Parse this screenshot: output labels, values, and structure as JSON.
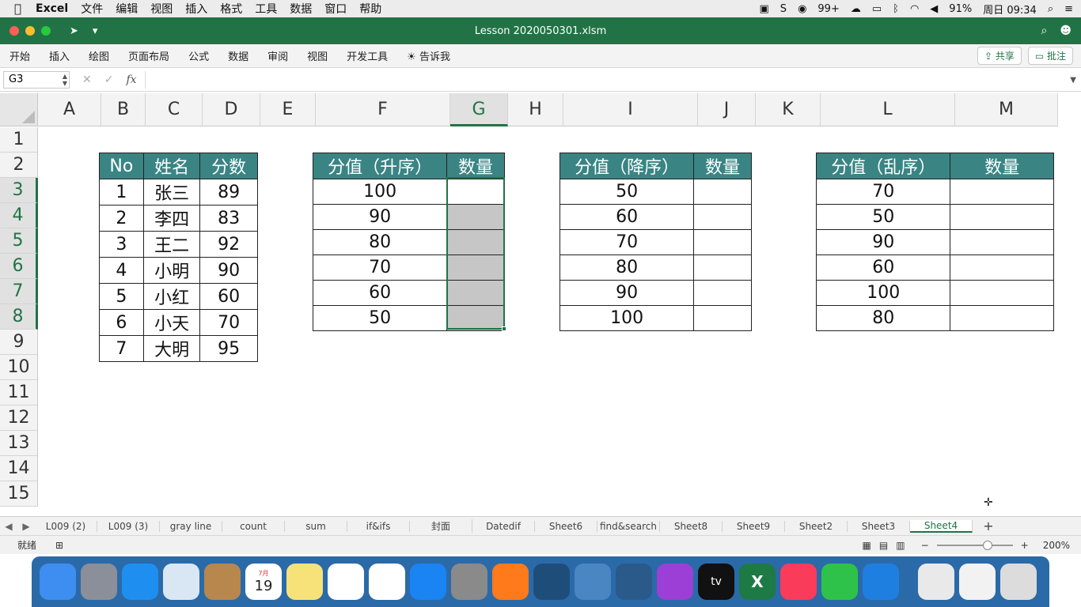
{
  "menubar": {
    "apple": "",
    "app": "Excel",
    "items": [
      "文件",
      "编辑",
      "视图",
      "插入",
      "格式",
      "工具",
      "数据",
      "窗口",
      "帮助"
    ],
    "status": {
      "badge": "99+",
      "battery": "91%",
      "clock": "周日 09:34"
    }
  },
  "window": {
    "title": "Lesson 2020050301.xlsm"
  },
  "ribbon": {
    "tabs": [
      "开始",
      "插入",
      "绘图",
      "页面布局",
      "公式",
      "数据",
      "审阅",
      "视图",
      "开发工具",
      "告诉我"
    ],
    "share": "共享",
    "comments": "批注"
  },
  "formula_bar": {
    "name_box": "G3",
    "fx": "fx",
    "value": ""
  },
  "columns": [
    "A",
    "B",
    "C",
    "D",
    "E",
    "F",
    "G",
    "H",
    "I",
    "J",
    "K",
    "L",
    "M"
  ],
  "rows": [
    "1",
    "2",
    "3",
    "4",
    "5",
    "6",
    "7",
    "8",
    "9",
    "10",
    "11",
    "12",
    "13",
    "14",
    "15"
  ],
  "selected": {
    "col": "G",
    "rows": [
      "3",
      "4",
      "5",
      "6",
      "7",
      "8"
    ]
  },
  "tables": {
    "students": {
      "headers": [
        "No",
        "姓名",
        "分数"
      ],
      "rows": [
        [
          "1",
          "张三",
          "89"
        ],
        [
          "2",
          "李四",
          "83"
        ],
        [
          "3",
          "王二",
          "92"
        ],
        [
          "4",
          "小明",
          "90"
        ],
        [
          "5",
          "小红",
          "60"
        ],
        [
          "6",
          "小天",
          "70"
        ],
        [
          "7",
          "大明",
          "95"
        ]
      ]
    },
    "asc": {
      "headers": [
        "分值（升序）",
        "数量"
      ],
      "values": [
        "100",
        "90",
        "80",
        "70",
        "60",
        "50"
      ]
    },
    "desc": {
      "headers": [
        "分值（降序）",
        "数量"
      ],
      "values": [
        "50",
        "60",
        "70",
        "80",
        "90",
        "100"
      ]
    },
    "random": {
      "headers": [
        "分值（乱序）",
        "数量"
      ],
      "values": [
        "70",
        "50",
        "90",
        "60",
        "100",
        "80"
      ]
    }
  },
  "sheet_tabs": [
    "L009 (2)",
    "L009 (3)",
    "gray line",
    "count",
    "sum",
    "if&ifs",
    "封面",
    "Datedif",
    "Sheet6",
    "find&search",
    "Sheet8",
    "Sheet9",
    "Sheet2",
    "Sheet3",
    "Sheet4"
  ],
  "active_sheet": "Sheet4",
  "status_bar": {
    "ready": "就绪",
    "zoom": "200%"
  },
  "colors": {
    "excel_green": "#217346",
    "table_header": "#3a8484",
    "selection_fill": "#c6c6c6"
  },
  "dock_icons": [
    "finder-icon",
    "launchpad-icon",
    "safari-icon",
    "mail-icon",
    "contacts-icon",
    "calendar-icon",
    "notes-icon",
    "reminders-icon",
    "photos-icon",
    "app-store-icon",
    "system-preferences-icon",
    "firefox-icon",
    "mysql-workbench-icon",
    "help-icon",
    "time-machine-icon",
    "podcasts-icon",
    "apple-tv-icon",
    "excel-icon",
    "itunes-icon",
    "wechat-icon",
    "sogou-icon",
    "document-icon",
    "screenshot-icon",
    "trash-icon"
  ],
  "dock": {
    "calendar_day": "19",
    "calendar_month": "7月",
    "appletv_label": "tv",
    "excel_label": "X"
  }
}
